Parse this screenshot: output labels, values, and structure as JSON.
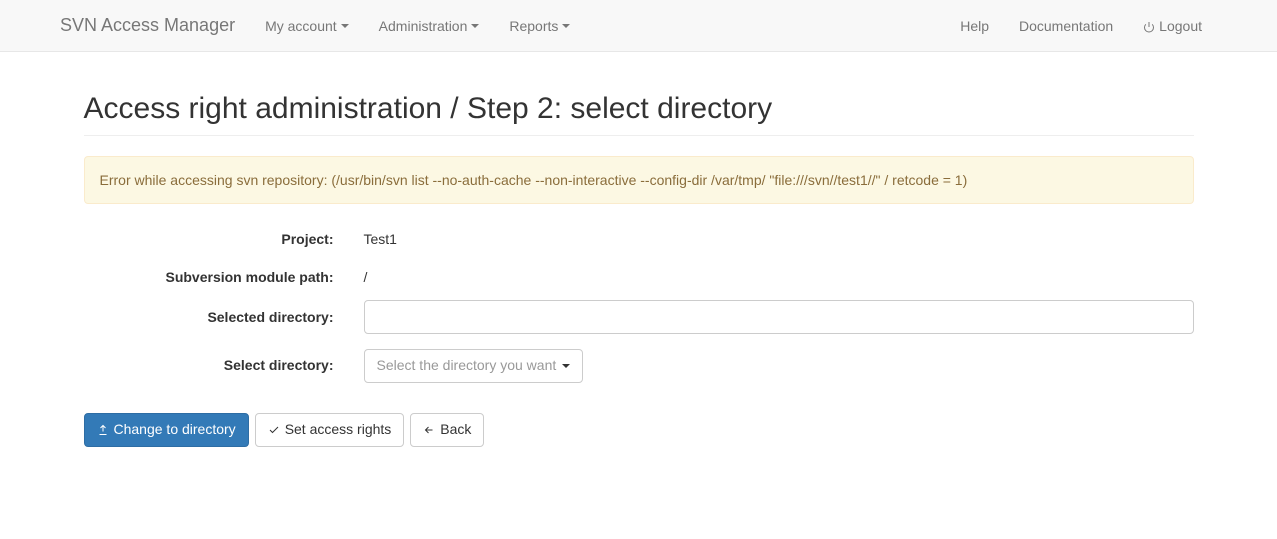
{
  "navbar": {
    "brand": "SVN Access Manager",
    "left": [
      {
        "label": "My account",
        "dropdown": true
      },
      {
        "label": "Administration",
        "dropdown": true
      },
      {
        "label": "Reports",
        "dropdown": true
      }
    ],
    "right": {
      "help": "Help",
      "documentation": "Documentation",
      "logout": "Logout"
    }
  },
  "page": {
    "title": "Access right administration / Step 2: select directory"
  },
  "alert": {
    "message": "Error while accessing svn repository: (/usr/bin/svn list --no-auth-cache --non-interactive --config-dir /var/tmp/ \"file:///svn//test1//\" / retcode = 1)"
  },
  "form": {
    "project_label": "Project:",
    "project_value": "Test1",
    "module_path_label": "Subversion module path:",
    "module_path_value": "/",
    "selected_directory_label": "Selected directory:",
    "selected_directory_value": "",
    "select_directory_label": "Select directory:",
    "select_directory_placeholder": "Select the directory you want"
  },
  "buttons": {
    "change": "Change to directory",
    "set_rights": "Set access rights",
    "back": "Back"
  }
}
